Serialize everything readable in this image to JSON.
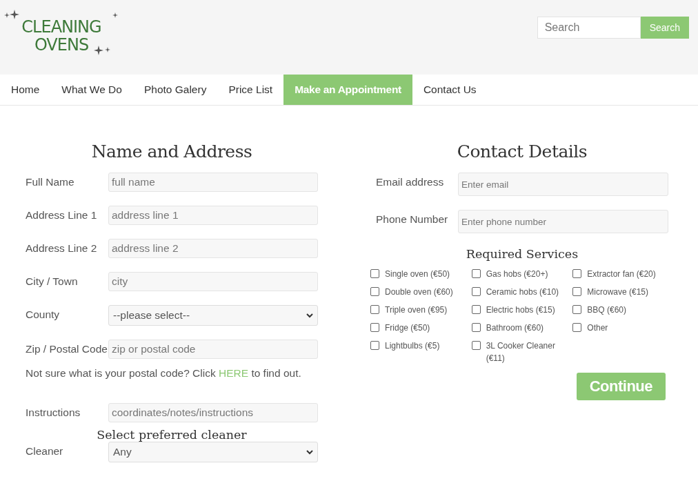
{
  "logo": {
    "line1": "CLEANING",
    "line2": "OVENS"
  },
  "search": {
    "placeholder": "Search",
    "button": "Search"
  },
  "nav": [
    {
      "label": "Home",
      "selected": false
    },
    {
      "label": "What We Do",
      "selected": false
    },
    {
      "label": "Photo Galery",
      "selected": false
    },
    {
      "label": "Price List",
      "selected": false
    },
    {
      "label": "Make an Appointment",
      "selected": true
    },
    {
      "label": "Contact Us",
      "selected": false
    }
  ],
  "address": {
    "title": "Name and Address",
    "fields": [
      {
        "label": "Full Name",
        "kind": "input",
        "placeholder": "full name"
      },
      {
        "label": "Address Line 1",
        "kind": "input",
        "placeholder": "address line 1"
      },
      {
        "label": "Address Line 2",
        "kind": "input",
        "placeholder": "address line 2"
      },
      {
        "label": "City / Town",
        "kind": "input",
        "placeholder": "city"
      },
      {
        "label": "County",
        "kind": "select",
        "value": "--please select--"
      },
      {
        "label": "Zip / Postal Code",
        "kind": "input",
        "placeholder": "zip or postal code"
      }
    ],
    "hint": {
      "before": "Not sure what is your postal code? Click",
      "link": "HERE",
      "after": "to find out."
    },
    "instructions": {
      "label": "Instructions",
      "placeholder": "coordinates/notes/instructions"
    },
    "cleaner_title": "Select preferred cleaner",
    "cleaner": {
      "label": "Cleaner",
      "value": "Any"
    }
  },
  "contact": {
    "title": "Contact Details",
    "fields": [
      {
        "label": "Email address",
        "placeholder": "Enter email"
      },
      {
        "label": "Phone Number",
        "placeholder": "Enter phone number"
      }
    ]
  },
  "services": {
    "title": "Required Services",
    "columns": [
      [
        {
          "label": "Single oven (€50)",
          "checked": false
        },
        {
          "label": "Double oven (€60)",
          "checked": false
        },
        {
          "label": "Triple oven (€95)",
          "checked": false
        },
        {
          "label": "Fridge (€50)",
          "checked": false
        },
        {
          "label": "Lightbulbs (€5)",
          "checked": false
        }
      ],
      [
        {
          "label": "Gas hobs (€20+)",
          "checked": false
        },
        {
          "label": "Ceramic hobs (€10)",
          "checked": false
        },
        {
          "label": "Electric hobs (€15)",
          "checked": false
        },
        {
          "label": "Bathroom (€60)",
          "checked": false
        },
        {
          "label": "3L Cooker Cleaner (€11)",
          "checked": false
        }
      ],
      [
        {
          "label": "Extractor fan (€20)",
          "checked": false
        },
        {
          "label": "Microwave (€15)",
          "checked": false
        },
        {
          "label": "BBQ (€60)",
          "checked": false
        },
        {
          "label": "Other",
          "checked": false
        }
      ]
    ]
  },
  "continue_button": "Continue"
}
